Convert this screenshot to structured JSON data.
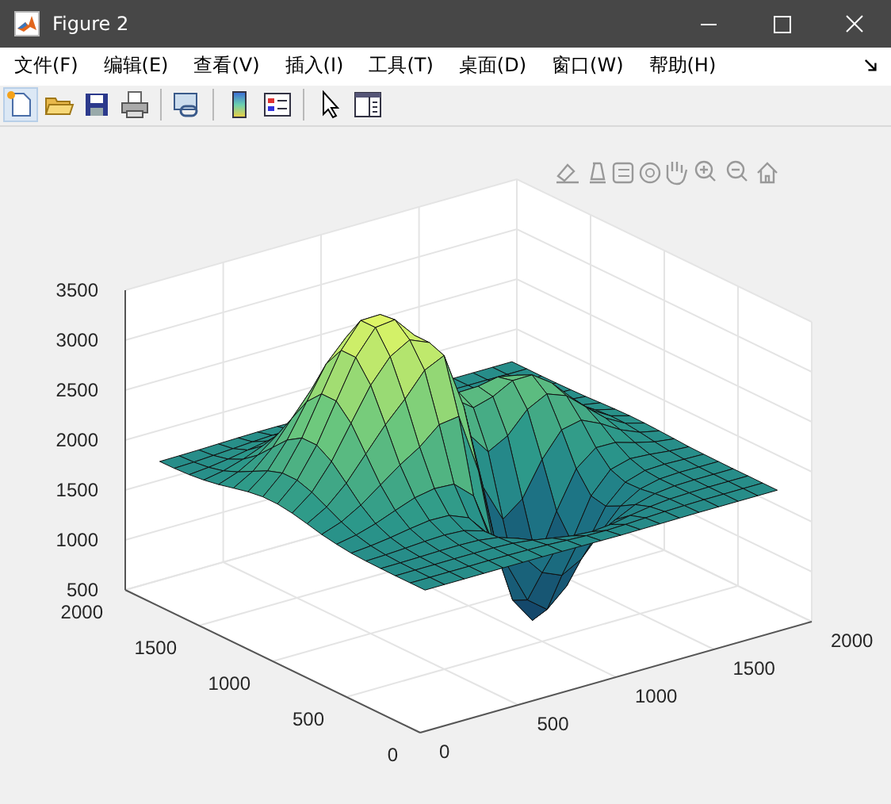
{
  "window": {
    "title": "Figure 2"
  },
  "menu": [
    "文件(F)",
    "编辑(E)",
    "查看(V)",
    "插入(I)",
    "工具(T)",
    "桌面(D)",
    "窗口(W)",
    "帮助(H)"
  ],
  "axes": {
    "x_ticks": [
      "0",
      "500",
      "1000",
      "1500",
      "2000"
    ],
    "y_ticks": [
      "0",
      "500",
      "1000",
      "1500",
      "2000"
    ],
    "z_ticks": [
      "3500",
      "3000",
      "2500",
      "2000",
      "1500",
      "1000",
      "500"
    ]
  }
}
